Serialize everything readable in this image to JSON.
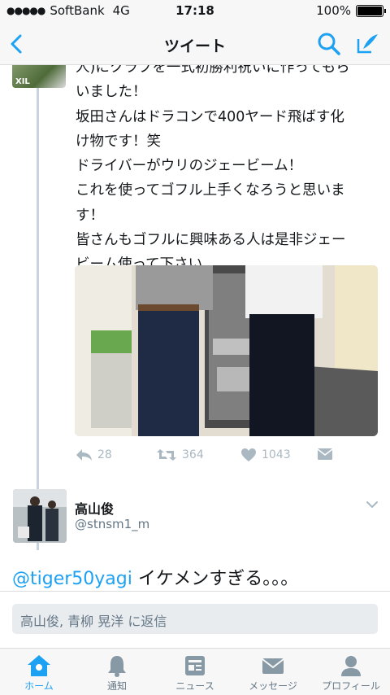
{
  "status_bar": {
    "carrier": "SoftBank",
    "network": "4G",
    "time": "17:18",
    "battery": "100%"
  },
  "nav": {
    "title": "ツイート",
    "back_icon": "chevron-left-icon",
    "search_icon": "search-icon",
    "compose_icon": "compose-icon"
  },
  "tweet": {
    "avatar_text": "XIL",
    "lines": [
      "人)にクラブを一式初勝利祝いに作ってもら",
      "いました！",
      "坂田さんはドラコンで400ヤード飛ばす化",
      "け物です！笑",
      "ドライバーがウリのジェービーム！",
      "これを使ってゴフル上手くなろうと思いま",
      "す！",
      "皆さんもゴフルに興味ある人は是非ジェー",
      "ビーム使って下さい"
    ],
    "actions": {
      "reply_count": "28",
      "retweet_count": "364",
      "like_count": "1043"
    }
  },
  "reply": {
    "name": "高山俊",
    "handle": "@stnsm1_m",
    "mention": "@tiger50yagi",
    "text": " イケメンすぎる。。。"
  },
  "compose": {
    "placeholder": "高山俊, 青柳 晃洋 に返信"
  },
  "tabs": [
    {
      "label": "ホーム",
      "icon": "home-icon",
      "active": true
    },
    {
      "label": "通知",
      "icon": "bell-icon",
      "active": false
    },
    {
      "label": "ニュース",
      "icon": "news-icon",
      "active": false
    },
    {
      "label": "メッセージ",
      "icon": "envelope-icon",
      "active": false
    },
    {
      "label": "プロフィール",
      "icon": "person-icon",
      "active": false
    }
  ],
  "colors": {
    "accent": "#1da1f2",
    "action_gray": "#aab8c2",
    "thread_line": "#c8d3de"
  }
}
